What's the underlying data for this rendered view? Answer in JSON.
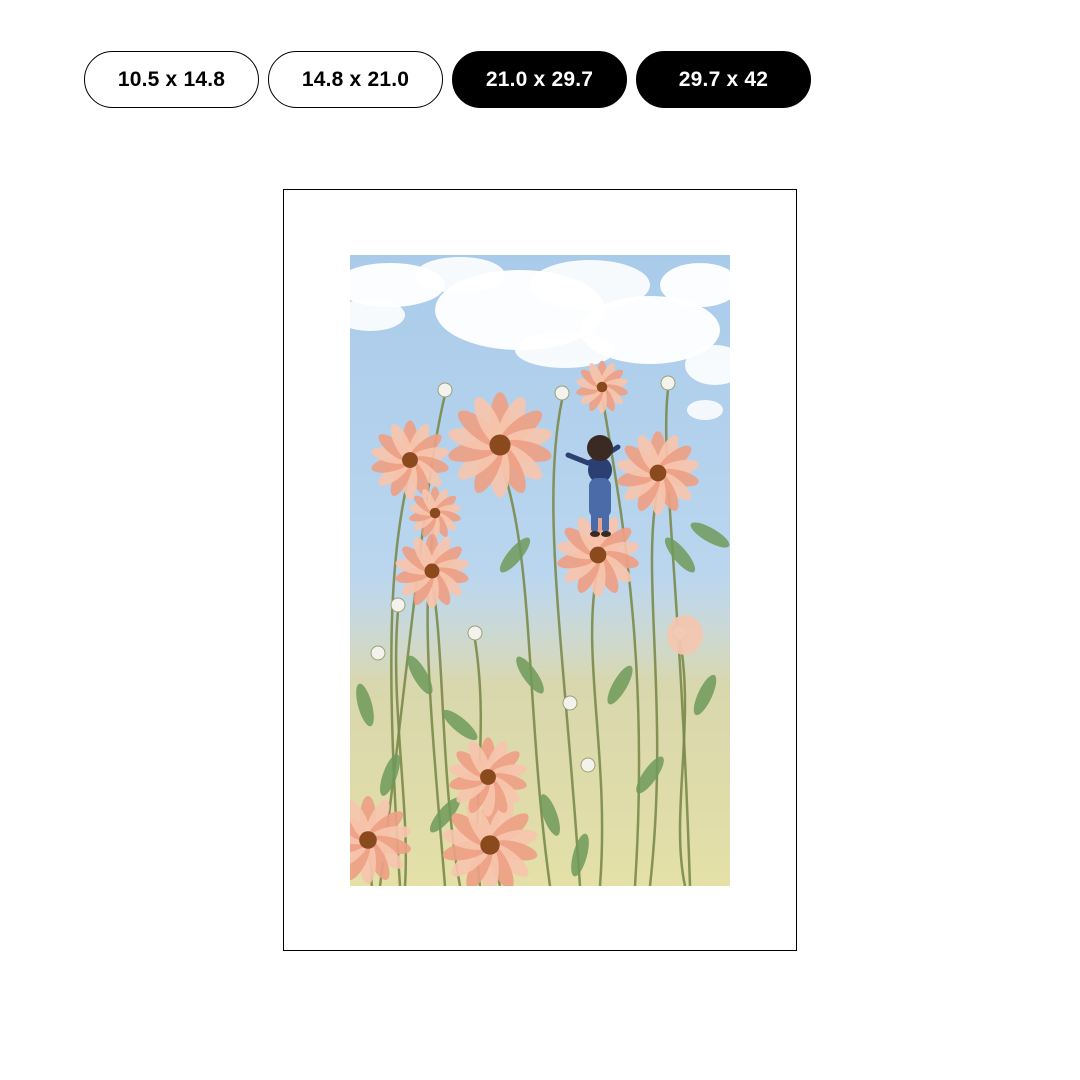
{
  "size_options": [
    {
      "label": "10.5 x 14.8",
      "selected": false
    },
    {
      "label": "14.8 x 21.0",
      "selected": false
    },
    {
      "label": "21.0 x 29.7",
      "selected": true
    },
    {
      "label": "29.7 x 42",
      "selected": true
    }
  ],
  "artwork": {
    "colors": {
      "sky_top": "#a9cbea",
      "sky_bottom": "#cfe2f1",
      "cloud": "#ffffff",
      "petal": "#f6c4ad",
      "petal_shade": "#ee9f86",
      "flower_center": "#8a4a1e",
      "stem": "#7a8a4a",
      "leaf": "#6f9a5a",
      "meadow": "#dcd89a"
    }
  }
}
